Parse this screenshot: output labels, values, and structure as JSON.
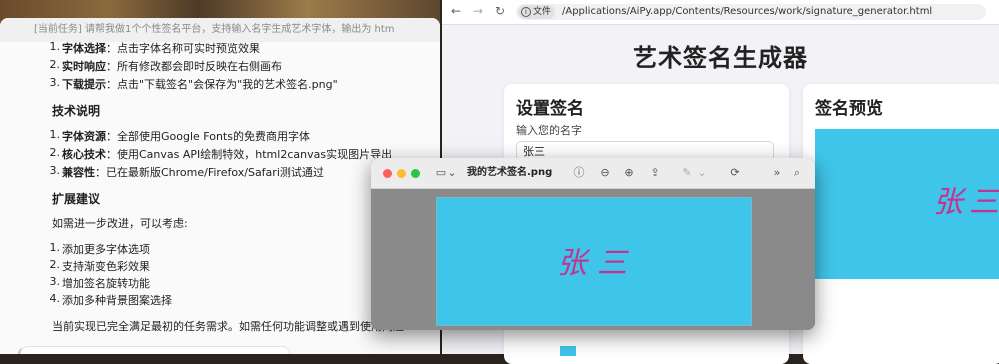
{
  "chat_window": {
    "title": "[当前任务] 请帮我做1个个性签名平台，支持输入名字生成艺术字体，输出为 htm",
    "usage_items": [
      {
        "num": "1.",
        "label": "字体选择",
        "text": "：点击字体名称可实时预览效果"
      },
      {
        "num": "2.",
        "label": "实时响应",
        "text": "：所有修改都会即时反映在右侧画布"
      },
      {
        "num": "3.",
        "label": "下载提示",
        "text": "：点击\"下载签名\"会保存为\"我的艺术签名.png\""
      }
    ],
    "tech_heading": "技术说明",
    "tech_items": [
      {
        "num": "1.",
        "label": "字体资源",
        "text": "：全部使用Google Fonts的免费商用字体"
      },
      {
        "num": "2.",
        "label": "核心技术",
        "text": "：使用Canvas API绘制特效，html2canvas实现图片导出"
      },
      {
        "num": "3.",
        "label": "兼容性",
        "text": "：已在最新版Chrome/Firefox/Safari测试通过"
      }
    ],
    "ext_heading": "扩展建议",
    "ext_intro": "如需进一步改进，可以考虑:",
    "ext_items": [
      {
        "num": "1.",
        "text": "添加更多字体选项"
      },
      {
        "num": "2.",
        "text": "支持渐变色彩效果"
      },
      {
        "num": "3.",
        "text": "增加签名旋转功能"
      },
      {
        "num": "4.",
        "text": "添加多种背景图案选择"
      }
    ],
    "closing": "当前实现已完全满足最初的任务需求。如需任何功能调整或遇到使用问题"
  },
  "browser": {
    "back_icon": "←",
    "forward_icon": "→",
    "reload_icon": "↻",
    "badge_label": "文件",
    "url": "/Applications/AiPy.app/Contents/Resources/work/signature_generator.html",
    "page_title": "艺术签名生成器",
    "settings_heading": "设置签名",
    "name_label": "输入您的名字",
    "name_value": "张三",
    "preview_heading": "签名预览",
    "preview_signature": "张三"
  },
  "viewer": {
    "filename": "我的艺术签名.png",
    "signature_text": "张三",
    "colors": {
      "background": "#40c5ea",
      "signature": "#c2348f"
    }
  }
}
